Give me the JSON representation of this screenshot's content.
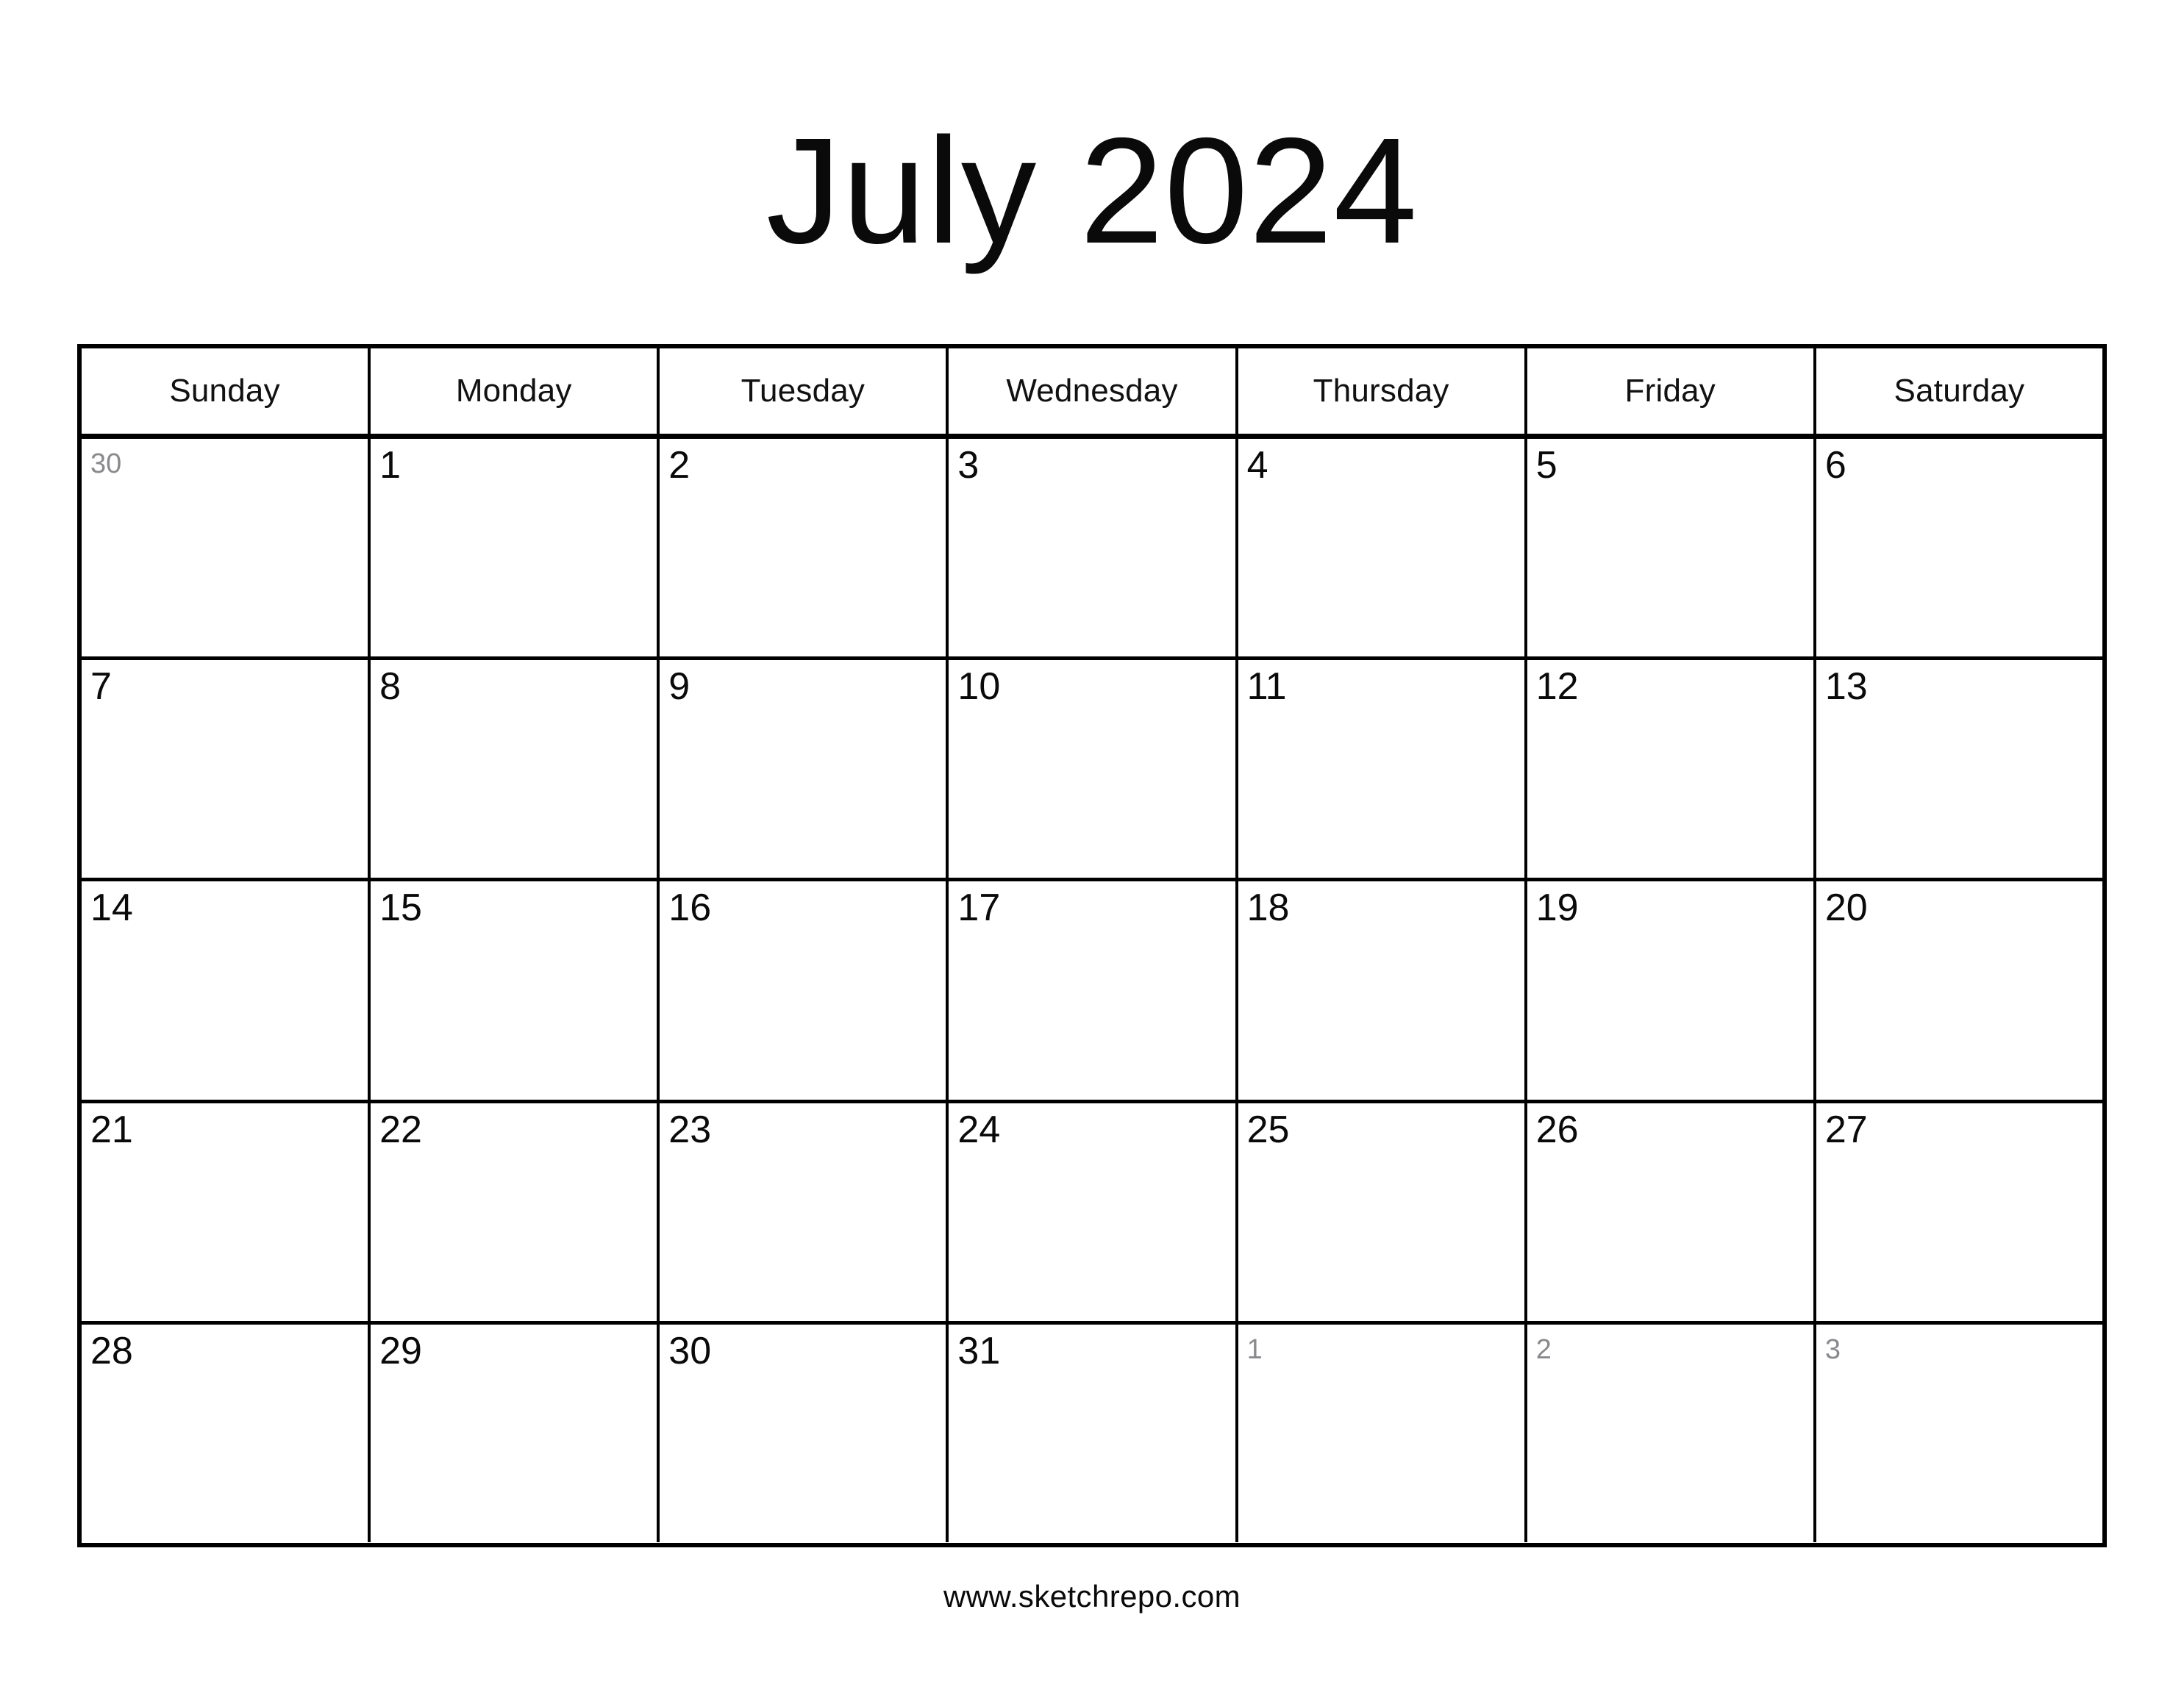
{
  "title": "July 2024",
  "month": "July",
  "year": "2024",
  "weekdays": [
    "Sunday",
    "Monday",
    "Tuesday",
    "Wednesday",
    "Thursday",
    "Friday",
    "Saturday"
  ],
  "weeks": [
    [
      {
        "num": "30",
        "muted": true
      },
      {
        "num": "1",
        "muted": false
      },
      {
        "num": "2",
        "muted": false
      },
      {
        "num": "3",
        "muted": false
      },
      {
        "num": "4",
        "muted": false
      },
      {
        "num": "5",
        "muted": false
      },
      {
        "num": "6",
        "muted": false
      }
    ],
    [
      {
        "num": "7",
        "muted": false
      },
      {
        "num": "8",
        "muted": false
      },
      {
        "num": "9",
        "muted": false
      },
      {
        "num": "10",
        "muted": false
      },
      {
        "num": "11",
        "muted": false
      },
      {
        "num": "12",
        "muted": false
      },
      {
        "num": "13",
        "muted": false
      }
    ],
    [
      {
        "num": "14",
        "muted": false
      },
      {
        "num": "15",
        "muted": false
      },
      {
        "num": "16",
        "muted": false
      },
      {
        "num": "17",
        "muted": false
      },
      {
        "num": "18",
        "muted": false
      },
      {
        "num": "19",
        "muted": false
      },
      {
        "num": "20",
        "muted": false
      }
    ],
    [
      {
        "num": "21",
        "muted": false
      },
      {
        "num": "22",
        "muted": false
      },
      {
        "num": "23",
        "muted": false
      },
      {
        "num": "24",
        "muted": false
      },
      {
        "num": "25",
        "muted": false
      },
      {
        "num": "26",
        "muted": false
      },
      {
        "num": "27",
        "muted": false
      }
    ],
    [
      {
        "num": "28",
        "muted": false
      },
      {
        "num": "29",
        "muted": false
      },
      {
        "num": "30",
        "muted": false
      },
      {
        "num": "31",
        "muted": false
      },
      {
        "num": "1",
        "muted": true
      },
      {
        "num": "2",
        "muted": true
      },
      {
        "num": "3",
        "muted": true
      }
    ]
  ],
  "footer": "www.sketchrepo.com",
  "colors": {
    "background": "#ffffff",
    "text": "#0a0a0a",
    "muted_text": "#8a8a8e",
    "grid_line": "#000000"
  }
}
